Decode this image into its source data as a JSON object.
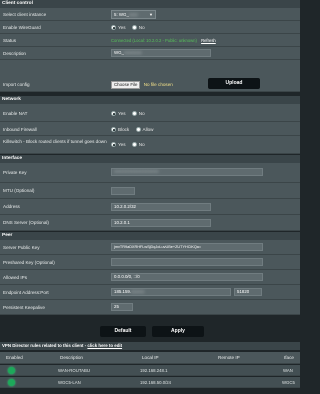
{
  "client_control": {
    "title": "Client control",
    "select_instance_label": "Select client instance",
    "select_instance_value": "5: WG_",
    "enable_wg_label": "Enable WireGuard",
    "enable_yes": "Yes",
    "enable_no": "No",
    "status_label": "Status",
    "status_text": "Connected (Local: 10.2.0.2 - Public: unknown)",
    "status_refresh": "Refresh",
    "description_label": "Description",
    "description_value": "WG_",
    "import_label": "Import config",
    "choose_file": "Choose File",
    "no_file": "No file chosen",
    "upload": "Upload"
  },
  "network": {
    "title": "Network",
    "nat_label": "Enable NAT",
    "nat_yes": "Yes",
    "nat_no": "No",
    "firewall_label": "Inbound Firewall",
    "firewall_block": "Block",
    "firewall_allow": "Allow",
    "killswitch_label": "Killswitch - Block routed clients if tunnel goes down",
    "killswitch_yes": "Yes",
    "killswitch_no": "No"
  },
  "interface": {
    "title": "Interface",
    "private_key_label": "Private Key",
    "private_key_value": "•••••••••••••••••••••••••••••",
    "mtu_label": "MTU (Optional)",
    "mtu_value": "",
    "address_label": "Address",
    "address_value": "10.2.0.2/32",
    "dns_label": "DNS Server (Optional)",
    "dns_value": "10.2.0.1"
  },
  "peer": {
    "title": "Peer",
    "pubkey_label": "Server Public Key",
    "pubkey_value": "jmvTR9aDXRHFLwSjDqJoLuvUBe+ZUTYHCiKQa=",
    "psk_label": "Preshared Key (Optional)",
    "psk_value": "",
    "allowed_label": "Allowed IPs",
    "allowed_value": "0.0.0.0/0, ::/0",
    "endpoint_label": "Endpoint Address:Port",
    "endpoint_value": "185.159.",
    "endpoint_port": "51820",
    "keepalive_label": "Persistent Keepalive",
    "keepalive_value": "25"
  },
  "actions": {
    "default": "Default",
    "apply": "Apply"
  },
  "vpn_director": {
    "title_prefix": "VPN Director rules related to this client - ",
    "title_link": "click here to edit",
    "columns": [
      "Enabled",
      "Description",
      "Local IP",
      "Remote IP",
      "Iface"
    ],
    "rows": [
      {
        "description": "WAN-ROUTABU",
        "local_ip": "192.168.248.1",
        "remote_ip": "",
        "iface": "WAN"
      },
      {
        "description": "WGC5-LAN",
        "local_ip": "192.168.50.0/24",
        "remote_ip": "",
        "iface": "WGC5"
      }
    ]
  },
  "colors": {
    "connected": "#57c05a",
    "enabled_dot": "#1da85a"
  }
}
